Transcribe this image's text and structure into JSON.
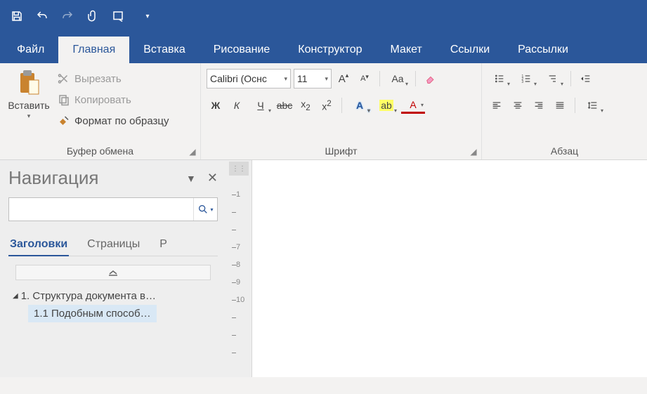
{
  "qat": {
    "items": [
      "save",
      "undo",
      "redo",
      "attach",
      "screenshot-tool"
    ]
  },
  "tabs": {
    "file": "Файл",
    "home": "Главная",
    "insert": "Вставка",
    "draw": "Рисование",
    "design": "Конструктор",
    "layout": "Макет",
    "references": "Ссылки",
    "mailings": "Рассылки",
    "active": "home"
  },
  "ribbon": {
    "clipboard": {
      "paste": "Вставить",
      "cut": "Вырезать",
      "copy": "Копировать",
      "format_painter": "Формат по образцу",
      "label": "Буфер обмена"
    },
    "font": {
      "name": "Calibri (Оснс",
      "size": "11",
      "label": "Шрифт",
      "bold_glyph": "Ж",
      "italic_glyph": "К",
      "underline_glyph": "Ч",
      "strike_glyph": "abc",
      "sub_glyph": "x",
      "sub_suffix": "2",
      "sup_glyph": "x",
      "sup_suffix": "2",
      "case_glyph": "Aa",
      "clear_icon": "eraser",
      "text_effects_glyph": "A",
      "highlight_glyph": "ab",
      "font_color_glyph": "A",
      "grow_glyph": "A",
      "shrink_glyph": "A"
    },
    "paragraph": {
      "label": "Абзац"
    }
  },
  "navigation": {
    "title": "Навигация",
    "search_placeholder": "",
    "tabs": {
      "headings": "Заголовки",
      "pages": "Страницы",
      "results": "Р"
    },
    "items": {
      "level1": "1. Структура документа в…",
      "level2": "1.1 Подобным способ…"
    }
  },
  "ruler_numbers": [
    "1",
    "7",
    "8",
    "9",
    "10"
  ],
  "colors": {
    "brand": "#2b579a"
  }
}
